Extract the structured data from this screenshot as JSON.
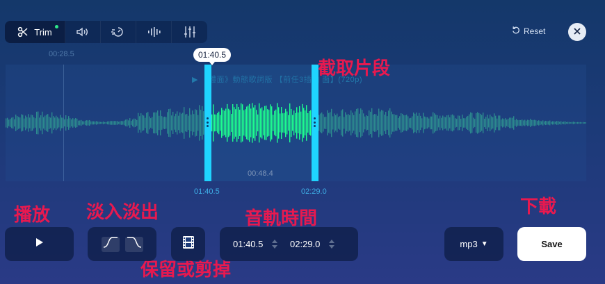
{
  "toolbar": {
    "items": [
      {
        "icon": "scissors-icon",
        "label": "Trim",
        "active": true
      },
      {
        "icon": "volume-icon"
      },
      {
        "icon": "speed-icon"
      },
      {
        "icon": "pitch-bars-icon"
      },
      {
        "icon": "equalizer-icon"
      }
    ]
  },
  "header": {
    "reset_label": "Reset",
    "reset_icon": "undo-icon",
    "close_icon": "close-icon"
  },
  "timeline": {
    "cursor_time": "00:28.5",
    "song_title": "▶ 《體面》動態歌詞版 【前任3插曲 面】(720p)",
    "start_tooltip": "01:40.5",
    "selection_duration": "00:48.4",
    "start_label": "01:40.5",
    "end_label": "02:29.0"
  },
  "annotations": {
    "clip": "截取片段",
    "play": "播放",
    "fade": "淡入淡出",
    "track_time": "音軌時間",
    "download": "下載",
    "keep_or_cut": "保留或剪掉"
  },
  "controls": {
    "play_icon": "play-icon",
    "fade_in_icon": "fade-in-icon",
    "fade_out_icon": "fade-out-icon",
    "keep_cut_icon": "film-strip-icon",
    "start_time": "01:40.5",
    "end_time": "02:29.0",
    "format": "mp3",
    "save_label": "Save"
  },
  "colors": {
    "selected_wave": "#1dff8f",
    "unselected_wave": "#2c8a8e",
    "handle": "#1fd4ff",
    "annotation": "#e8194f"
  }
}
